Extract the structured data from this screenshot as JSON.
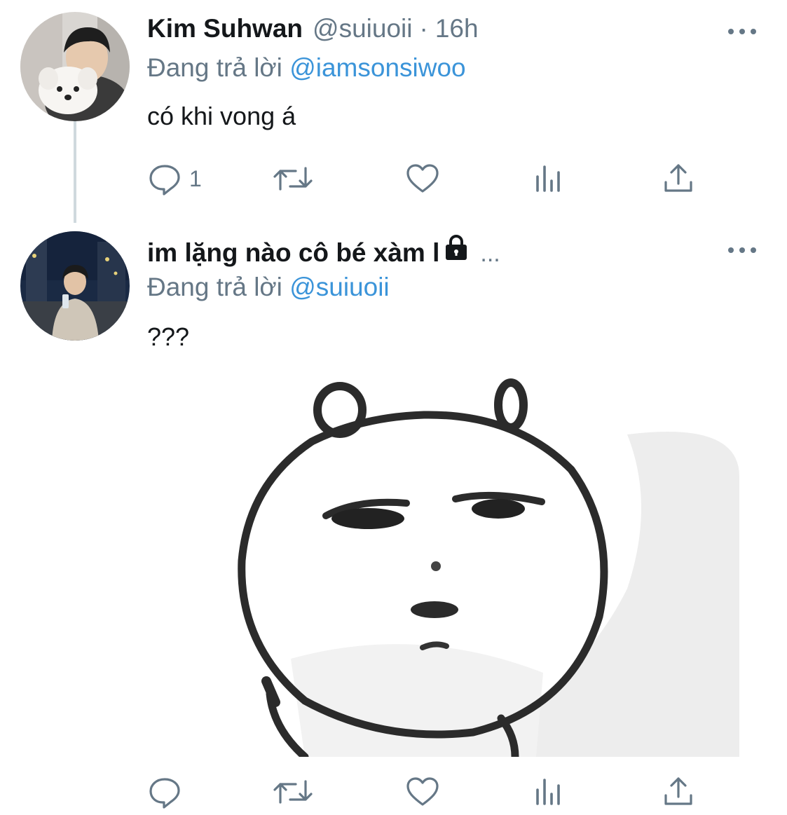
{
  "tweets": [
    {
      "name": "Kim Suhwan",
      "handle": "@suiuoii",
      "separator": "·",
      "time": "16h",
      "replying_prefix": "Đang trả lời ",
      "replying_to": "@iamsonsiwoo",
      "text": "có khi vong á",
      "reply_count": "1",
      "icons": [
        "reply-icon",
        "retweet-icon",
        "like-icon",
        "analytics-icon",
        "share-icon",
        "more-icon"
      ]
    },
    {
      "name": "im lặng nào cô bé xàm l",
      "name_overflow": "...",
      "protected": true,
      "replying_prefix": "Đang trả lời ",
      "replying_to": "@suiuoii",
      "text": "???",
      "media": "sketch-bear-face",
      "icons": [
        "lock-icon",
        "reply-icon",
        "retweet-icon",
        "like-icon",
        "analytics-icon",
        "share-icon",
        "more-icon"
      ]
    }
  ],
  "colors": {
    "text": "#14171a",
    "secondary": "#657786",
    "link": "#3b94d9",
    "thread_line": "#cfd9de"
  }
}
